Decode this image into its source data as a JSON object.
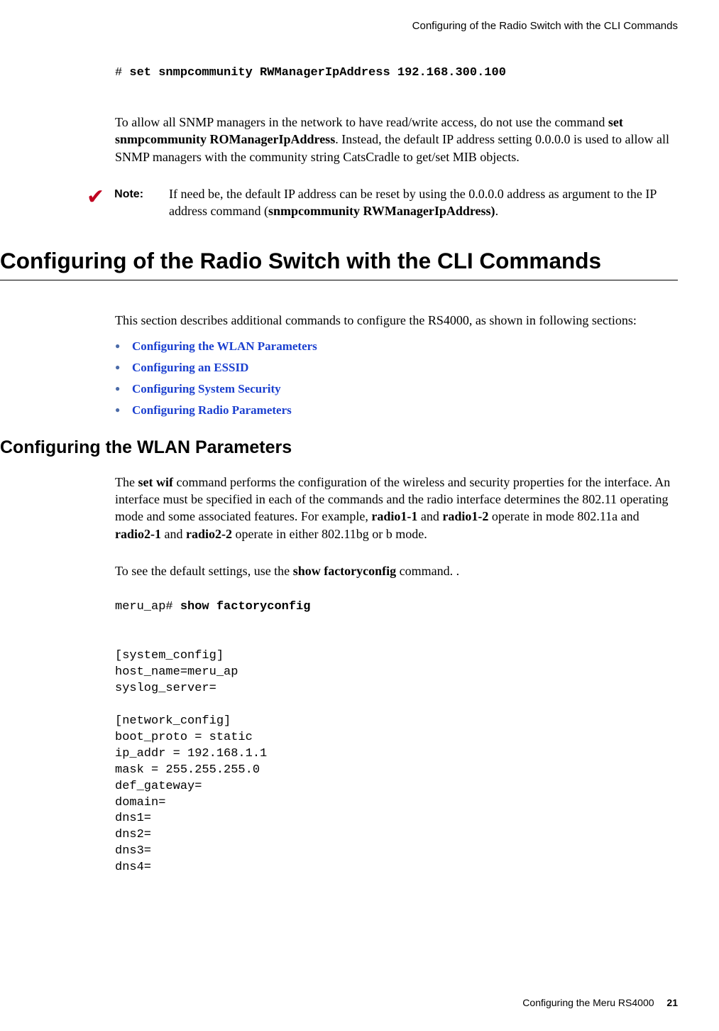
{
  "header": {
    "running_title": "Configuring of the Radio Switch with the CLI Commands"
  },
  "cmd1": {
    "prompt": "# ",
    "command": "set snmpcommunity RWManagerIpAddress 192.168.300.100"
  },
  "para1": {
    "t1": "To allow all SNMP managers in the network to have read/write access, do not use the command ",
    "b1": "set snmpcommunity ROManagerIpAddress",
    "t2": ". Instead, the default IP address setting 0.0.0.0 is used to allow all SNMP managers with the community string CatsCradle to get/set MIB objects."
  },
  "note": {
    "label": "Note:",
    "t1": "If need be, the default IP address can be reset by using the 0.0.0.0 address as argument to the IP address command (",
    "b1": "snmpcommunity RWManagerIpAddress)",
    "t2": "."
  },
  "h1": "Configuring of the Radio Switch with the CLI Commands",
  "intro": "This section describes additional commands to configure the RS4000, as shown in following sections:",
  "links": [
    "Configuring the WLAN Parameters",
    "Configuring an ESSID",
    "Configuring System Security",
    "Configuring Radio Parameters"
  ],
  "h2": "Configuring the WLAN Parameters",
  "para2": {
    "t1": "The ",
    "b1": "set wif",
    "t2": " command performs the configuration of the wireless and security properties for the interface. An interface must be specified in each of the commands and the radio interface determines the 802.11 operating mode and some associated features. For example, ",
    "b2": "radio1-1",
    "t3": " and ",
    "b3": "radio1-2",
    "t4": " operate in mode 802.11a and ",
    "b4": "radio2-1",
    "t5": " and ",
    "b5": "radio2-2",
    "t6": " operate in either 802.11bg or b mode."
  },
  "para3": {
    "t1": "To see the default settings, use the ",
    "b1": "show factoryconfig",
    "t2": " command. ."
  },
  "cli": {
    "prompt": "meru_ap# ",
    "command": "show factoryconfig",
    "output": "[system_config]\nhost_name=meru_ap\nsyslog_server=\n\n[network_config]\nboot_proto = static\nip_addr = 192.168.1.1\nmask = 255.255.255.0\ndef_gateway=\ndomain=\ndns1=\ndns2=\ndns3=\ndns4="
  },
  "footer": {
    "text": "Configuring the Meru RS4000",
    "page": "21"
  }
}
